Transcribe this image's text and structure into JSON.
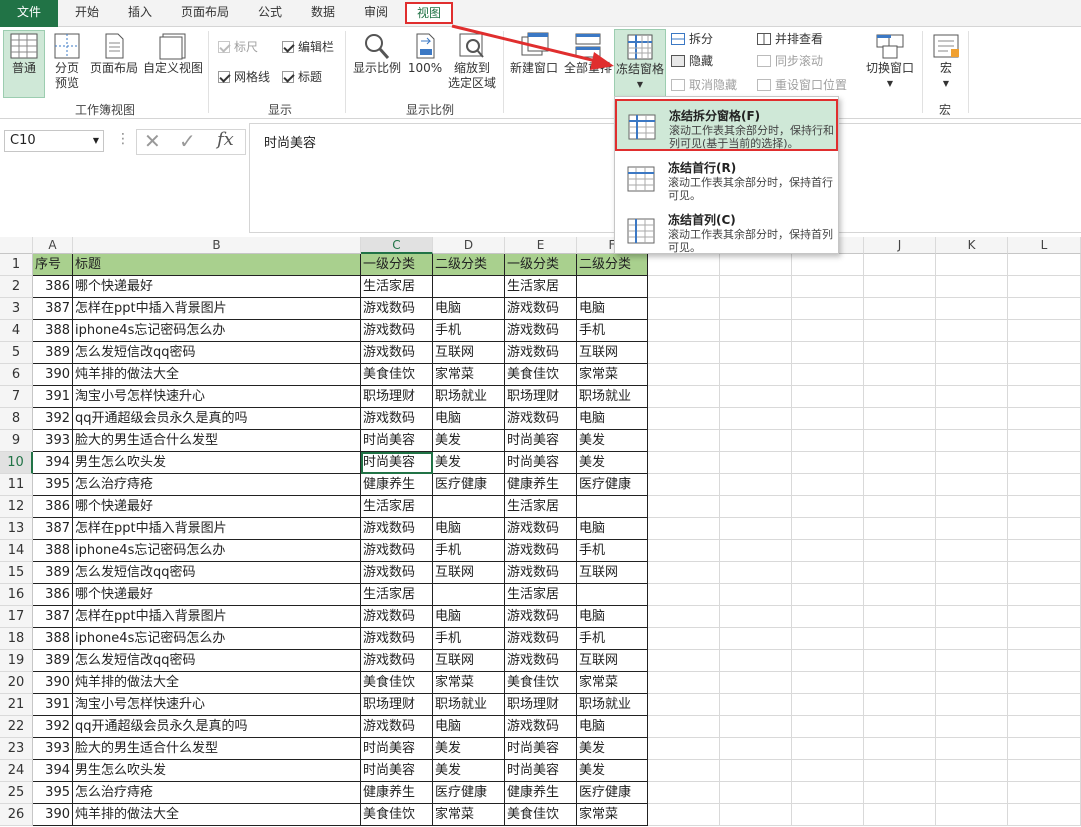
{
  "tabs": {
    "file": "文件",
    "home": "开始",
    "insert": "插入",
    "layout": "页面布局",
    "formulas": "公式",
    "data": "数据",
    "review": "审阅",
    "view": "视图"
  },
  "ribbon": {
    "workbook_views": {
      "normal": "普通",
      "page_break": [
        "分页",
        "预览"
      ],
      "page_layout": "页面布局",
      "custom_view": "自定义视图",
      "group": "工作簿视图"
    },
    "show": {
      "ruler": "标尺",
      "formula_bar": "编辑栏",
      "gridlines": "网格线",
      "headings": "标题",
      "group": "显示"
    },
    "zoom": {
      "zoom": "显示比例",
      "hundred": "100%",
      "zoom_selection": [
        "缩放到",
        "选定区域"
      ],
      "group": "显示比例"
    },
    "window": {
      "new_window": "新建窗口",
      "arrange_all": "全部重排",
      "freeze": "冻结窗格",
      "split": "拆分",
      "hide": "隐藏",
      "unhide": "取消隐藏",
      "side_by_side": "并排查看",
      "sync_scroll": "同步滚动",
      "reset_position": "重设窗口位置",
      "switch": "切换窗口"
    },
    "macros": {
      "macros": "宏",
      "group": "宏"
    }
  },
  "formula_bar": {
    "name_box": "C10",
    "value": "时尚美容"
  },
  "columns": [
    "A",
    "B",
    "C",
    "D",
    "E",
    "F",
    "G",
    "H",
    "I",
    "J",
    "K",
    "L"
  ],
  "header_row": [
    "序号",
    "标题",
    "一级分类",
    "二级分类",
    "一级分类",
    "二级分类"
  ],
  "rows": [
    [
      "386",
      "哪个快递最好",
      "生活家居",
      "",
      "生活家居",
      ""
    ],
    [
      "387",
      "怎样在ppt中插入背景图片",
      "游戏数码",
      "电脑",
      "游戏数码",
      "电脑"
    ],
    [
      "388",
      "iphone4s忘记密码怎么办",
      "游戏数码",
      "手机",
      "游戏数码",
      "手机"
    ],
    [
      "389",
      "怎么发短信改qq密码",
      "游戏数码",
      "互联网",
      "游戏数码",
      "互联网"
    ],
    [
      "390",
      "炖羊排的做法大全",
      "美食佳饮",
      "家常菜",
      "美食佳饮",
      "家常菜"
    ],
    [
      "391",
      "淘宝小号怎样快速升心",
      "职场理财",
      "职场就业",
      "职场理财",
      "职场就业"
    ],
    [
      "392",
      "qq开通超级会员永久是真的吗",
      "游戏数码",
      "电脑",
      "游戏数码",
      "电脑"
    ],
    [
      "393",
      "脸大的男生适合什么发型",
      "时尚美容",
      "美发",
      "时尚美容",
      "美发"
    ],
    [
      "394",
      "男生怎么吹头发",
      "时尚美容",
      "美发",
      "时尚美容",
      "美发"
    ],
    [
      "395",
      "怎么治疗痔疮",
      "健康养生",
      "医疗健康",
      "健康养生",
      "医疗健康"
    ],
    [
      "386",
      "哪个快递最好",
      "生活家居",
      "",
      "生活家居",
      ""
    ],
    [
      "387",
      "怎样在ppt中插入背景图片",
      "游戏数码",
      "电脑",
      "游戏数码",
      "电脑"
    ],
    [
      "388",
      "iphone4s忘记密码怎么办",
      "游戏数码",
      "手机",
      "游戏数码",
      "手机"
    ],
    [
      "389",
      "怎么发短信改qq密码",
      "游戏数码",
      "互联网",
      "游戏数码",
      "互联网"
    ],
    [
      "386",
      "哪个快递最好",
      "生活家居",
      "",
      "生活家居",
      ""
    ],
    [
      "387",
      "怎样在ppt中插入背景图片",
      "游戏数码",
      "电脑",
      "游戏数码",
      "电脑"
    ],
    [
      "388",
      "iphone4s忘记密码怎么办",
      "游戏数码",
      "手机",
      "游戏数码",
      "手机"
    ],
    [
      "389",
      "怎么发短信改qq密码",
      "游戏数码",
      "互联网",
      "游戏数码",
      "互联网"
    ],
    [
      "390",
      "炖羊排的做法大全",
      "美食佳饮",
      "家常菜",
      "美食佳饮",
      "家常菜"
    ],
    [
      "391",
      "淘宝小号怎样快速升心",
      "职场理财",
      "职场就业",
      "职场理财",
      "职场就业"
    ],
    [
      "392",
      "qq开通超级会员永久是真的吗",
      "游戏数码",
      "电脑",
      "游戏数码",
      "电脑"
    ],
    [
      "393",
      "脸大的男生适合什么发型",
      "时尚美容",
      "美发",
      "时尚美容",
      "美发"
    ],
    [
      "394",
      "男生怎么吹头发",
      "时尚美容",
      "美发",
      "时尚美容",
      "美发"
    ],
    [
      "395",
      "怎么治疗痔疮",
      "健康养生",
      "医疗健康",
      "健康养生",
      "医疗健康"
    ],
    [
      "390",
      "炖羊排的做法大全",
      "美食佳饮",
      "家常菜",
      "美食佳饮",
      "家常菜"
    ]
  ],
  "freeze_menu": [
    {
      "title": "冻结拆分窗格(F)",
      "desc": "滚动工作表其余部分时，保持行和列可见(基于当前的选择)。"
    },
    {
      "title": "冻结首行(R)",
      "desc": "滚动工作表其余部分时，保持首行可见。"
    },
    {
      "title": "冻结首列(C)",
      "desc": "滚动工作表其余部分时，保持首列可见。"
    }
  ],
  "colors": {
    "excel_green": "#217346",
    "header_fill": "#a9d08e",
    "highlight_red": "#e02e2e"
  }
}
